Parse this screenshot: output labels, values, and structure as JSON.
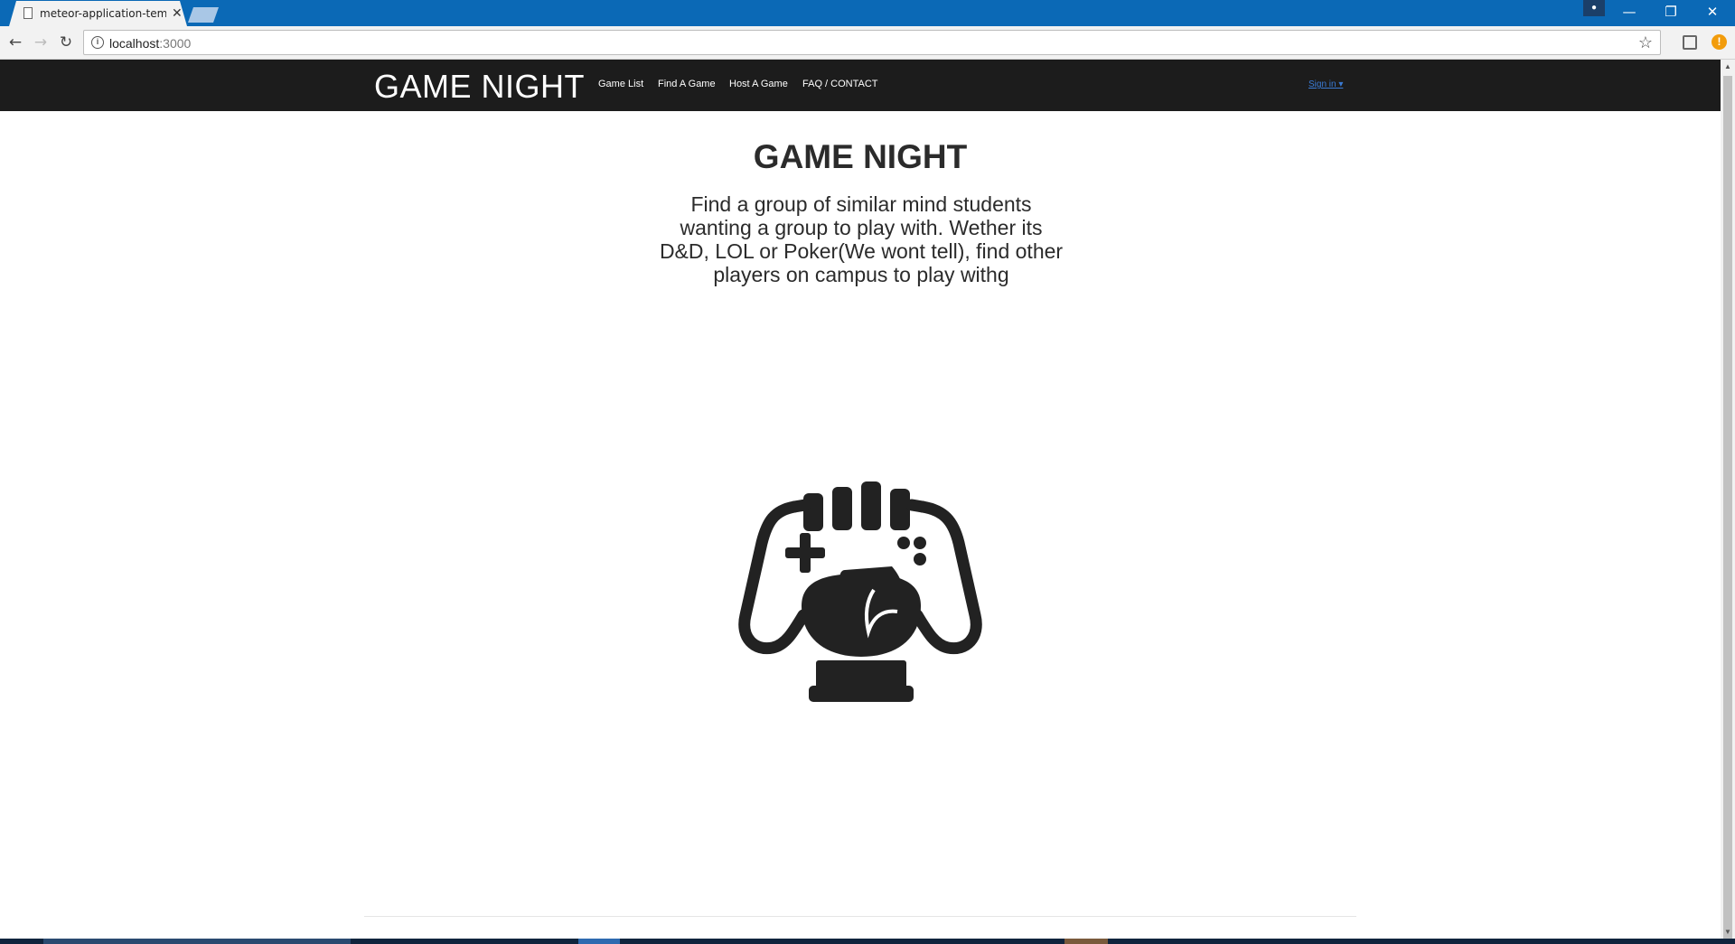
{
  "browser": {
    "tab_title": "meteor-application-temp",
    "url_host": "localhost",
    "url_port": ":3000"
  },
  "site": {
    "brand": "GAME NIGHT",
    "nav": [
      "Game List",
      "Find A Game",
      "Host A Game",
      "FAQ / CONTACT"
    ],
    "signin": "Sign in ▾"
  },
  "hero": {
    "title": "GAME NIGHT",
    "text": "Find a group of similar mind students wanting a group to play with. Wether its D&D, LOL or Poker(We wont tell), find other players on campus to play withg"
  },
  "icons": {
    "hero_logo": "game-controller-trophy-icon"
  },
  "colors": {
    "navbar": "#1c1c1c",
    "titlebar": "#0b69b6",
    "link": "#3a7bd5",
    "logo": "#222222"
  }
}
